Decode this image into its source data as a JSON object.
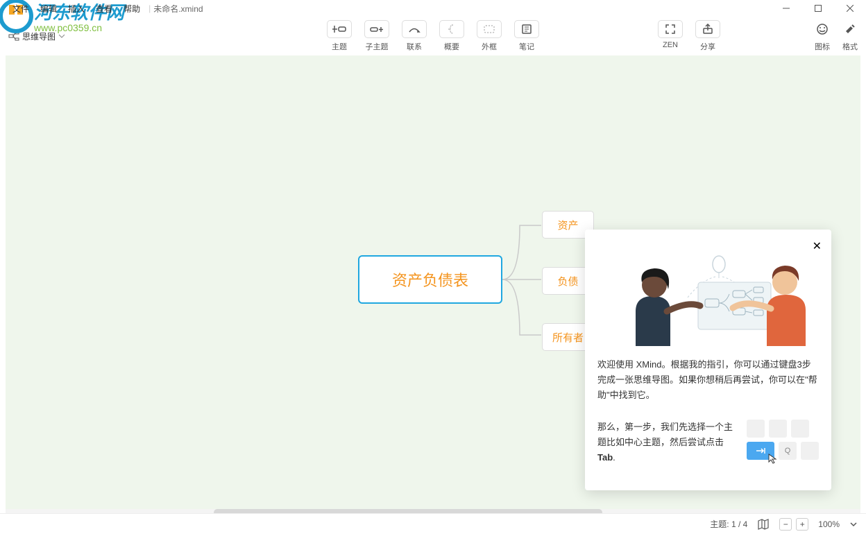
{
  "menu": {
    "file": "文件",
    "edit": "编辑",
    "insert": "插入",
    "view": "查看",
    "help": "帮助",
    "filename": "未命名.xmind"
  },
  "topbar": {
    "mindmap_tab": "思维导图",
    "tools": {
      "topic": "主题",
      "subtopic": "子主题",
      "relation": "联系",
      "summary": "概要",
      "boundary": "外框",
      "notes": "笔记",
      "zen": "ZEN",
      "share": "分享",
      "icon": "图标",
      "format": "格式"
    }
  },
  "mindmap": {
    "central": "资产负债表",
    "b1": "资产",
    "b2": "负债",
    "b3": "所有者"
  },
  "tutorial": {
    "text": "欢迎使用 XMind。根据我的指引，你可以通过键盘3步完成一张思维导图。如果你想稍后再尝试，你可以在\"帮助\"中找到它。",
    "step_prefix": "那么，第一步，我们先选择一个主题比如中心主题，然后尝试点击 ",
    "step_bold": "Tab",
    "key_q": "Q"
  },
  "statusbar": {
    "topic_label": "主题:",
    "topic_count": "1 / 4",
    "zoom": "100%"
  },
  "watermark": {
    "line1": "河东软件网",
    "line2": "www.pc0359.cn"
  }
}
